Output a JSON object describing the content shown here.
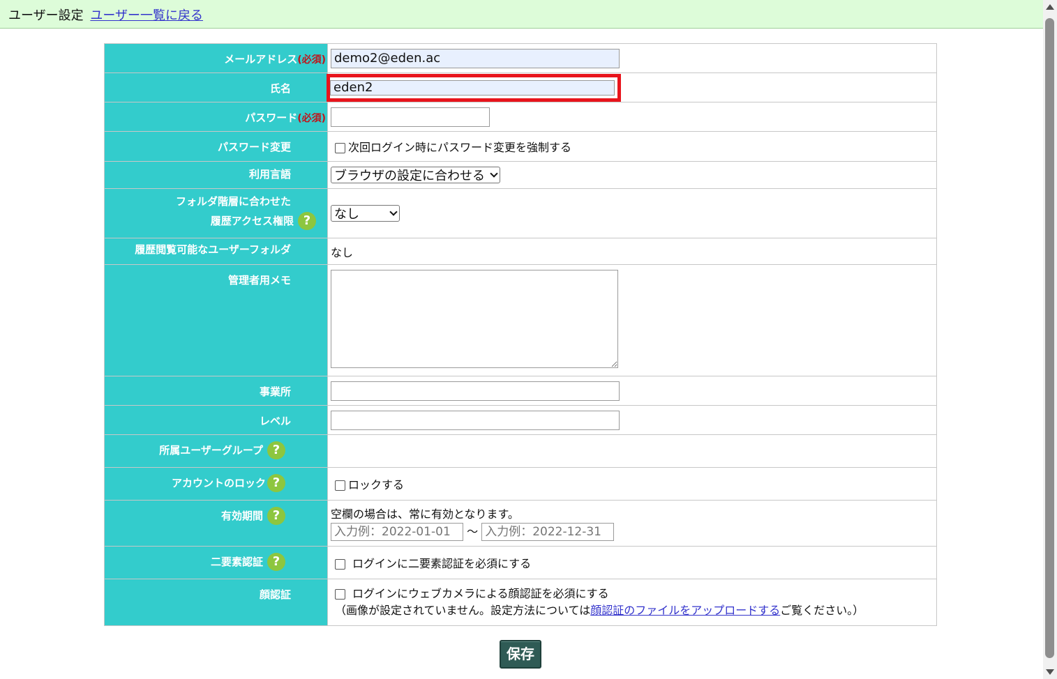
{
  "header": {
    "title": "ユーザー設定",
    "back_link": "ユーザー一覧に戻る"
  },
  "required_tag": "(必須)",
  "fields": {
    "email": {
      "label": "メールアドレス",
      "value": "demo2@eden.ac"
    },
    "name": {
      "label": "氏名",
      "value": "eden2"
    },
    "password": {
      "label": "パスワード",
      "value": ""
    },
    "password_change": {
      "label": "パスワード変更",
      "checkbox_label": "次回ログイン時にパスワード変更を強制する"
    },
    "language": {
      "label": "利用言語",
      "selected": "ブラウザの設定に合わせる"
    },
    "folder_access": {
      "label_line1": "フォルダ階層に合わせた",
      "label_line2": "履歴アクセス権限",
      "selected": "なし"
    },
    "viewable_folders": {
      "label": "履歴閲覧可能なユーザーフォルダ",
      "value": "なし"
    },
    "admin_memo": {
      "label": "管理者用メモ",
      "value": ""
    },
    "office": {
      "label": "事業所",
      "value": ""
    },
    "level": {
      "label": "レベル",
      "value": ""
    },
    "user_groups": {
      "label": "所属ユーザーグループ"
    },
    "account_lock": {
      "label": "アカウントのロック",
      "checkbox_label": "ロックする"
    },
    "validity": {
      "label": "有効期間",
      "note": "空欄の場合は、常に有効となります。",
      "start_placeholder": "入力例：2022-01-01",
      "separator": "～",
      "end_placeholder": "入力例：2022-12-31"
    },
    "two_factor": {
      "label": "二要素認証",
      "checkbox_label": "ログインに二要素認証を必須にする"
    },
    "face_auth": {
      "label": "顔認証",
      "checkbox_label": "ログインにウェブカメラによる顔認証を必須にする",
      "note_prefix": "（画像が設定されていません。設定方法については",
      "note_link": "顔認証のファイルをアップロードする",
      "note_suffix": "ご覧ください。）"
    }
  },
  "help_glyph": "?",
  "save_label": "保存",
  "colors": {
    "header_bg": "#ddfcd9",
    "label_bg": "#33cccc",
    "required": "#c0141a",
    "help": "#8dc63f",
    "save_btn": "#2f5b55",
    "highlight": "#e8141c"
  }
}
